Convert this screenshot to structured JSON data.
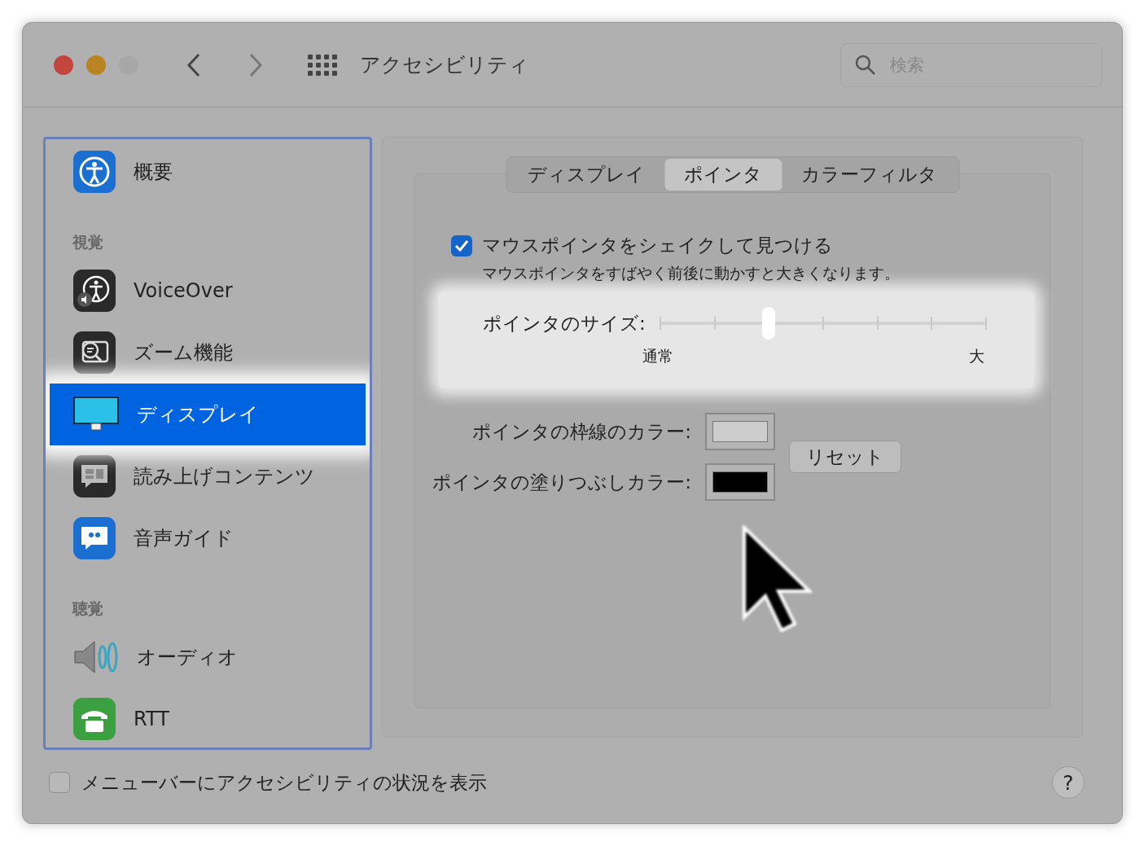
{
  "window": {
    "title": "アクセシビリティ"
  },
  "search": {
    "placeholder": "検索"
  },
  "sidebar": {
    "items": [
      {
        "kind": "item",
        "label": "概要",
        "selected": false
      },
      {
        "kind": "header",
        "label": "視覚"
      },
      {
        "kind": "item",
        "label": "VoiceOver",
        "selected": false
      },
      {
        "kind": "item",
        "label": "ズーム機能",
        "selected": false
      },
      {
        "kind": "item",
        "label": "ディスプレイ",
        "selected": true
      },
      {
        "kind": "item",
        "label": "読み上げコンテンツ",
        "selected": false
      },
      {
        "kind": "item",
        "label": "音声ガイド",
        "selected": false
      },
      {
        "kind": "header",
        "label": "聴覚"
      },
      {
        "kind": "item",
        "label": "オーディオ",
        "selected": false
      },
      {
        "kind": "item",
        "label": "RTT",
        "selected": false
      }
    ]
  },
  "tabs": [
    {
      "label": "ディスプレイ",
      "selected": false
    },
    {
      "label": "ポインタ",
      "selected": true
    },
    {
      "label": "カラーフィルタ",
      "selected": false
    }
  ],
  "shake": {
    "label": "マウスポインタをシェイクして見つける",
    "checked": true,
    "description": "マウスポインタをすばやく前後に動かすと大きくなります。"
  },
  "pointer_size": {
    "label": "ポインタのサイズ:",
    "level": 0.333,
    "min_label": "通常",
    "max_label": "大"
  },
  "colors": [
    {
      "label": "ポインタの枠線のカラー:",
      "color": "#cccccc"
    },
    {
      "label": "ポインタの塗りつぶしカラー:",
      "color": "#000000"
    }
  ],
  "reset_button": "リセット",
  "menu_bar_status": {
    "label": "メニューバーにアクセシビリティの状況を表示",
    "checked": false
  },
  "help_button": "?"
}
